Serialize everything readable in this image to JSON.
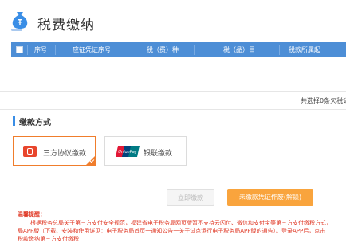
{
  "header": {
    "title": "税费缴纳"
  },
  "table": {
    "columns": [
      "序号",
      "应征凭证序号",
      "税（费）种",
      "税（品）目",
      "税款所属起"
    ]
  },
  "summary": {
    "text": "共选择0条欠税记"
  },
  "payment_section": {
    "title": "缴款方式",
    "options": [
      {
        "label": "三方协议缴款",
        "selected": true
      },
      {
        "label": "银联缴款",
        "selected": false
      }
    ],
    "bank_logo_text": "UnionPay"
  },
  "actions": {
    "pay_label": "立即缴款",
    "void_label": "未缴款凭证作废(解锁)"
  },
  "notice": {
    "title": "温馨提醒：",
    "lines": [
      "根据税务总局关于第三方支付安全规范，福建省电子税务局网页版暂不支持云闪付、微信和支付宝等第三方支付缴税方式，",
      "局APP版（下载、安装和使用详见：电子税务局首页一通知公告一关于试点运行电子税务局APP版的通告）。登录APP后，点击",
      "税款缴纳第三方支付缴税"
    ]
  },
  "colors": {
    "accent": "#4d8ed6",
    "orange": "#f07d2c",
    "warning": "#e03b28"
  }
}
